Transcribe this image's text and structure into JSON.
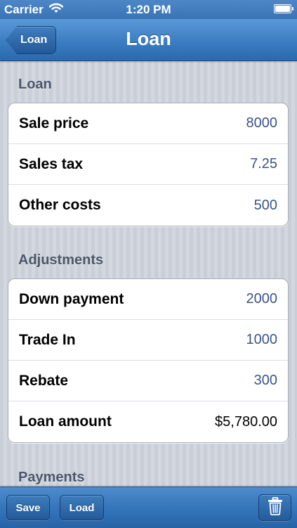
{
  "status_bar": {
    "carrier": "Carrier",
    "time": "1:20 PM",
    "icons": [
      "wifi-icon",
      "battery-icon"
    ]
  },
  "nav_bar": {
    "back_label": "Loan",
    "title": "Loan"
  },
  "sections": {
    "loan": {
      "header": "Loan",
      "rows": [
        {
          "label": "Sale price",
          "value": "8000"
        },
        {
          "label": "Sales tax",
          "value": "7.25"
        },
        {
          "label": "Other costs",
          "value": "500"
        }
      ]
    },
    "adjustments": {
      "header": "Adjustments",
      "rows": [
        {
          "label": "Down payment",
          "value": "2000"
        },
        {
          "label": "Trade In",
          "value": "1000"
        },
        {
          "label": "Rebate",
          "value": "300"
        },
        {
          "label": "Loan amount",
          "value": "$5,780.00"
        }
      ]
    },
    "payments": {
      "header": "Payments"
    }
  },
  "toolbar": {
    "save_label": "Save",
    "load_label": "Load",
    "trash_icon": "trash-icon"
  },
  "colors": {
    "bar_blue": "#3b7dc2",
    "value_blue": "#3a5486",
    "section_header": "#4c566a",
    "background": "#cdd2da"
  }
}
